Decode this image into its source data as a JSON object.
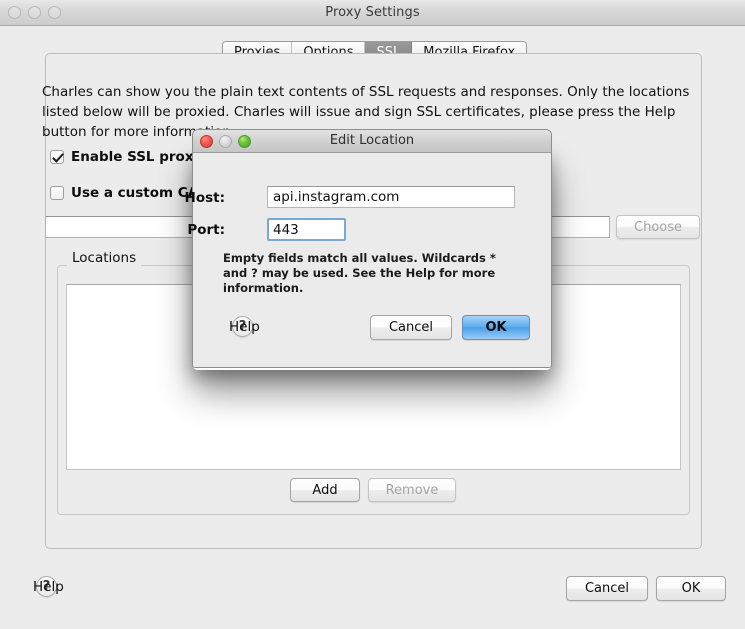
{
  "window": {
    "title": "Proxy Settings",
    "traffic_lights": [
      "close",
      "minimize",
      "zoom"
    ]
  },
  "tabs": [
    {
      "label": "Proxies",
      "active": false
    },
    {
      "label": "Options",
      "active": false
    },
    {
      "label": "SSL",
      "active": true
    },
    {
      "label": "Mozilla Firefox",
      "active": false
    }
  ],
  "ssl_panel": {
    "intro": "Charles can show you the plain text contents of SSL requests and responses. Only the locations listed below will be proxied. Charles will issue and sign SSL certificates, please press the Help button for more information.",
    "enable_ssl": {
      "label": "Enable SSL proxying",
      "checked": true
    },
    "custom_ca": {
      "label": "Use a custom CA ce",
      "checked": false
    },
    "ca_path_value": "",
    "choose_label": "Choose",
    "locations_legend": "Locations",
    "locations_items": [],
    "add_label": "Add",
    "remove_label": "Remove"
  },
  "footer": {
    "help_label": "Help",
    "help_glyph": "?",
    "cancel_label": "Cancel",
    "ok_label": "OK"
  },
  "dialog": {
    "title": "Edit Location",
    "host_label": "Host:",
    "host_value": "api.instagram.com",
    "port_label": "Port:",
    "port_value": "443",
    "note": "Empty fields match all values. Wildcards * and ? may be used. See the Help for more information.",
    "help_label": "Help",
    "help_glyph": "?",
    "cancel_label": "Cancel",
    "ok_label": "OK"
  },
  "colors": {
    "window_bg": "#ececec",
    "accent_blue": "#4ca1ec",
    "focus_ring": "#79a8d4",
    "active_tab_bg": "#8a8a8a"
  }
}
